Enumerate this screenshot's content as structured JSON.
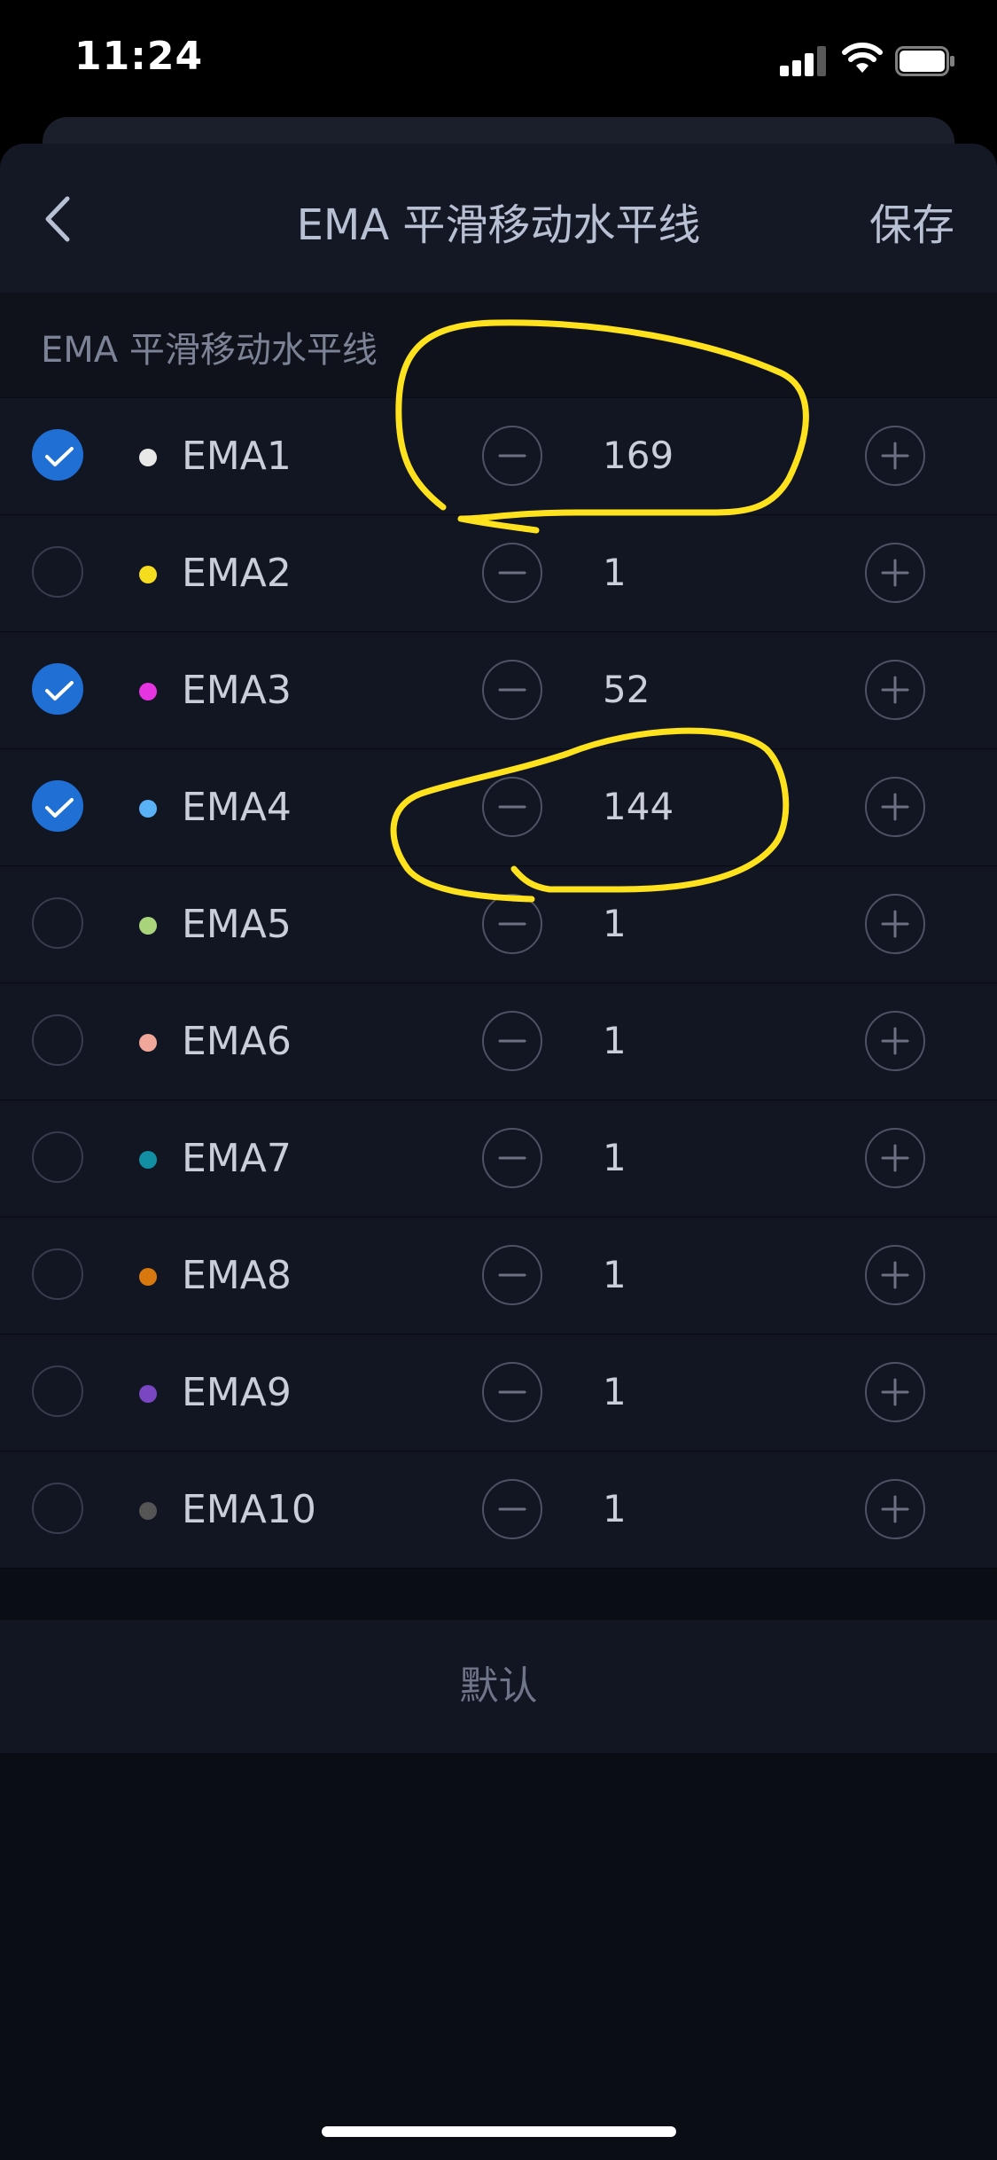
{
  "status_bar": {
    "time": "11:24"
  },
  "nav": {
    "title": "EMA 平滑移动水平线",
    "save_label": "保存"
  },
  "section": {
    "title": "EMA 平滑移动水平线"
  },
  "items": [
    {
      "label": "EMA1",
      "value": "169",
      "checked": true,
      "color": "#e8e8e8"
    },
    {
      "label": "EMA2",
      "value": "1",
      "checked": false,
      "color": "#f5dc1e"
    },
    {
      "label": "EMA3",
      "value": "52",
      "checked": true,
      "color": "#e534e0"
    },
    {
      "label": "EMA4",
      "value": "144",
      "checked": true,
      "color": "#5ab1f5"
    },
    {
      "label": "EMA5",
      "value": "1",
      "checked": false,
      "color": "#a9d47c"
    },
    {
      "label": "EMA6",
      "value": "1",
      "checked": false,
      "color": "#f2a79b"
    },
    {
      "label": "EMA7",
      "value": "1",
      "checked": false,
      "color": "#138fa3"
    },
    {
      "label": "EMA8",
      "value": "1",
      "checked": false,
      "color": "#d9780f"
    },
    {
      "label": "EMA9",
      "value": "1",
      "checked": false,
      "color": "#7a46c2"
    },
    {
      "label": "EMA10",
      "value": "1",
      "checked": false,
      "color": "#555555"
    }
  ],
  "default_label": "默认",
  "colors": {
    "accent": "#1f6fd4",
    "annotation": "#ffe21e"
  }
}
